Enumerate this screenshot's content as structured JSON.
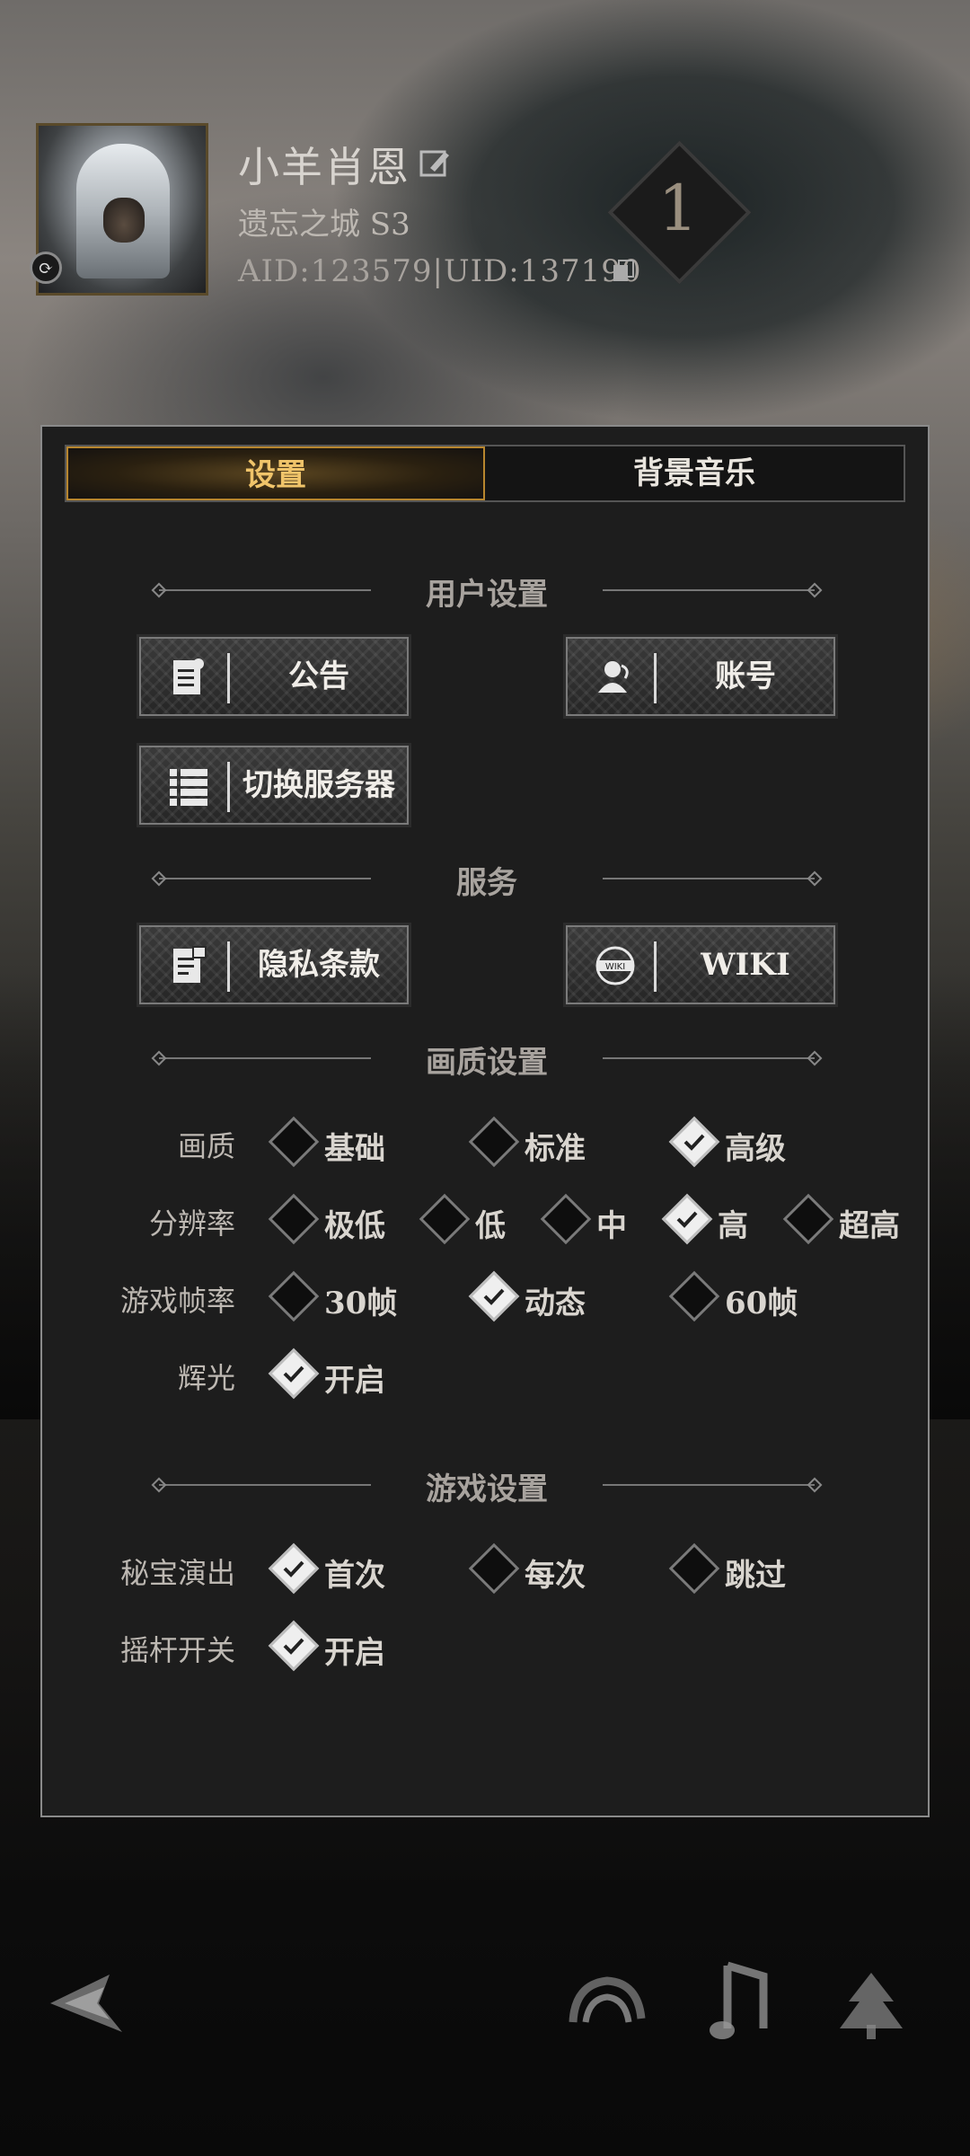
{
  "profile": {
    "name": "小羊肖恩",
    "realm": "遗忘之城 S3",
    "ids": "AID:123579|UID:137190",
    "rank": "1"
  },
  "tabs": [
    {
      "label": "设置",
      "active": true
    },
    {
      "label": "背景音乐",
      "active": false
    }
  ],
  "sections": {
    "user": "用户设置",
    "service": "服务",
    "quality": "画质设置",
    "game": "游戏设置"
  },
  "buttons": {
    "announcement": "公告",
    "account": "账号",
    "switch_server": "切换服务器",
    "privacy": "隐私条款",
    "wiki": "WIKI"
  },
  "options": {
    "quality": {
      "label": "画质",
      "choices": [
        "基础",
        "标准",
        "高级"
      ],
      "selected": "高级"
    },
    "resolution": {
      "label": "分辨率",
      "choices": [
        "极低",
        "低",
        "中",
        "高",
        "超高"
      ],
      "selected": "高"
    },
    "framerate": {
      "label": "游戏帧率",
      "choices": [
        "30帧",
        "动态",
        "60帧"
      ],
      "selected": "动态"
    },
    "glow": {
      "label": "辉光",
      "choices": [
        "开启"
      ],
      "selected": "开启"
    },
    "treasure": {
      "label": "秘宝演出",
      "choices": [
        "首次",
        "每次",
        "跳过"
      ],
      "selected": "首次"
    },
    "joystick": {
      "label": "摇杆开关",
      "choices": [
        "开启"
      ],
      "selected": "开启"
    }
  },
  "colors": {
    "accent_gold": "#f0c46a",
    "panel_bg": "#1d1d1d",
    "checked": "#efefef"
  },
  "icons": {
    "back": "back-arrow-icon",
    "nav1": "cloud-emblem-icon",
    "nav2": "music-note-icon",
    "nav3": "tree-emblem-icon"
  }
}
